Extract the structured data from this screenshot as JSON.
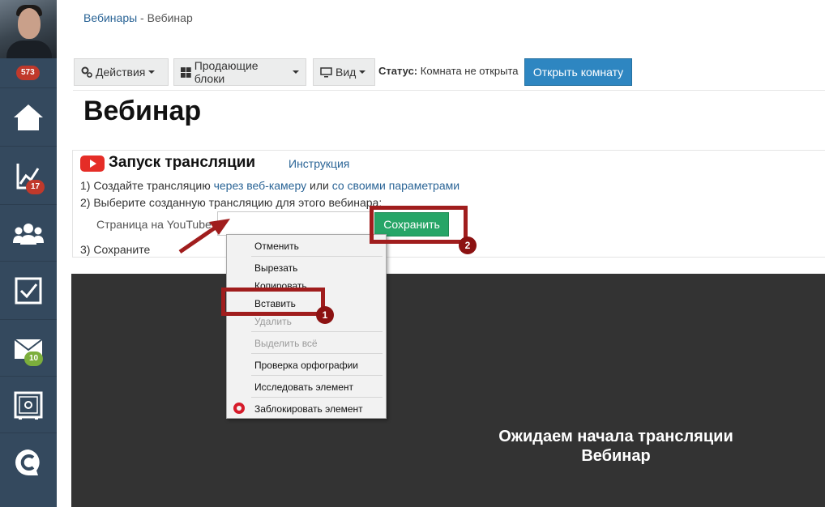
{
  "sidebar": {
    "notifications_count": "573",
    "items": [
      {
        "icon": "home-icon"
      },
      {
        "icon": "chart-icon",
        "badge": "17"
      },
      {
        "icon": "users-icon"
      },
      {
        "icon": "tasks-icon"
      },
      {
        "icon": "mail-icon",
        "badge": "10"
      },
      {
        "icon": "safe-icon"
      },
      {
        "icon": "brand-icon"
      }
    ]
  },
  "breadcrumb": {
    "parent": "Вебинары",
    "separator": " - ",
    "current": "Вебинар"
  },
  "toolbar": {
    "actions": "Действия",
    "blocks": "Продающие блоки",
    "view": "Вид",
    "status_label": "Статус:",
    "status_value": "Комната не открыта",
    "open_room": "Открыть комнату"
  },
  "page_title": "Вебинар",
  "broadcast": {
    "title": "Запуск трансляции",
    "instruction_link": "Инструкция",
    "step1_prefix": "1) Создайте трансляцию ",
    "step1_link1": "через веб-камеру",
    "step1_mid": " или ",
    "step1_link2": "со своими параметрами",
    "step2": "2) Выберите созданную трансляцию для этого вебинара:",
    "youtube_label": "Страница на YouTube:",
    "youtube_value": "",
    "save_button": "Сохранить",
    "step3": "3) Сохраните"
  },
  "video": {
    "waiting_line1": "Ожидаем начала трансляции",
    "waiting_line2": "Вебинар"
  },
  "context_menu": {
    "items": [
      "Отменить",
      "Вырезать",
      "Копировать",
      "Вставить",
      "Удалить",
      "Выделить всё",
      "Проверка орфографии",
      "Исследовать элемент",
      "Заблокировать элемент"
    ]
  },
  "annotations": {
    "marker1": "1",
    "marker2": "2"
  },
  "colors": {
    "sidebar": "#34495e",
    "primary": "#2e86c1",
    "success": "#27a567",
    "highlight": "#a01d1d",
    "video_bg": "#333333"
  }
}
